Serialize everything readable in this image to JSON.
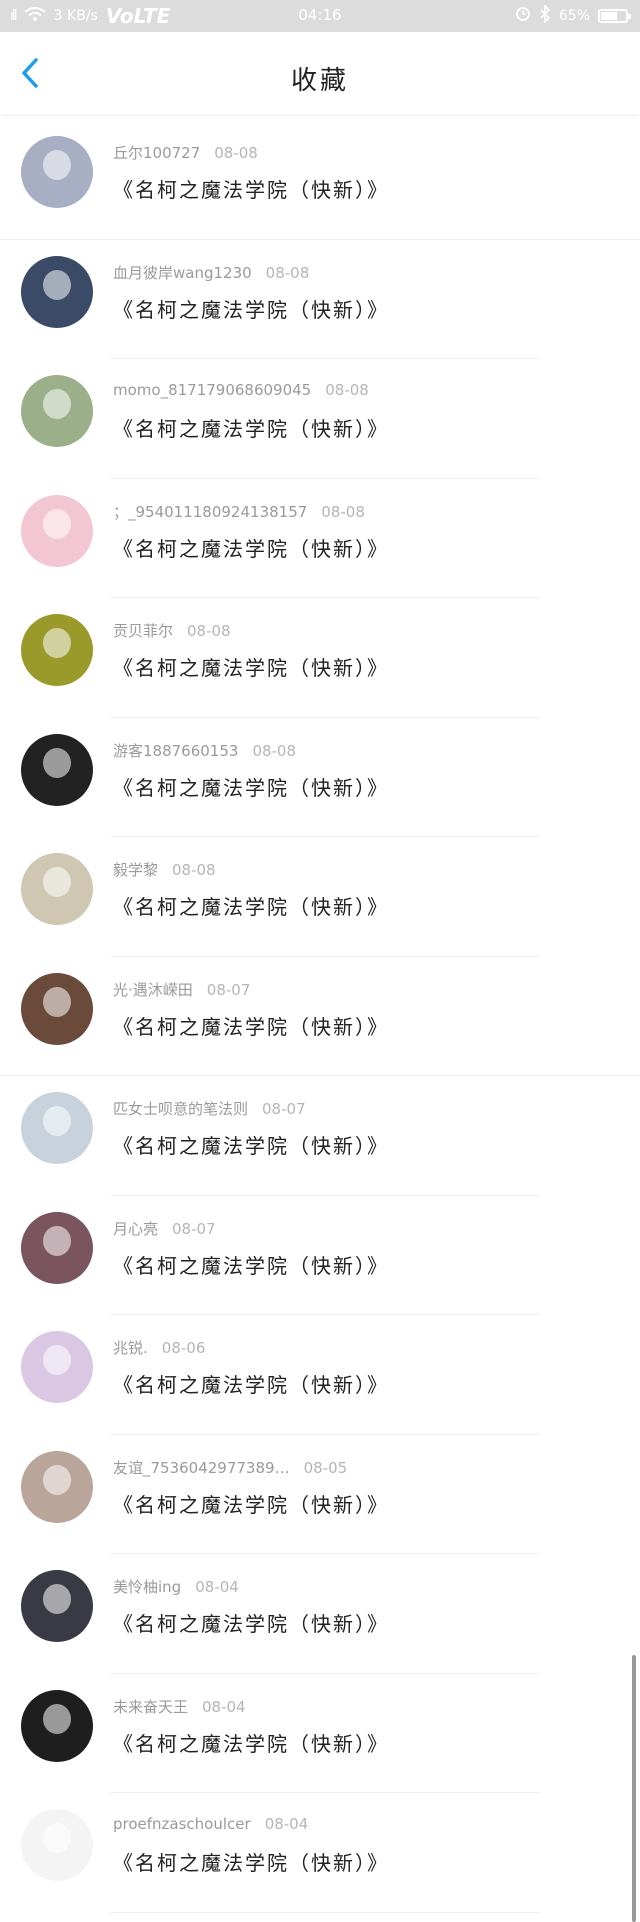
{
  "status_bar": {
    "signal": "ıll",
    "network_speed": "3 KB/s",
    "volte": "VoLTE",
    "time": "04:16",
    "battery_percent": "65%",
    "battery_level": 0.65
  },
  "header": {
    "title": "收藏"
  },
  "items": [
    {
      "user": "丘尔100727",
      "date": "08-08",
      "content": "《名柯之魔法学院（快新）》",
      "avatar_color": "#a8aec4"
    },
    {
      "user": "血月彼岸wang1230",
      "date": "08-08",
      "content": "《名柯之魔法学院（快新）》",
      "avatar_color": "#3b4a66"
    },
    {
      "user": "momo_817179068609045",
      "date": "08-08",
      "content": "《名柯之魔法学院（快新）》",
      "avatar_color": "#9bb08a"
    },
    {
      "user": "；_954011180924138157",
      "date": "08-08",
      "content": "《名柯之魔法学院（快新）》",
      "avatar_color": "#f3c6d3"
    },
    {
      "user": "贡贝菲尔",
      "date": "08-08",
      "content": "《名柯之魔法学院（快新）》",
      "avatar_color": "#9a9a2a"
    },
    {
      "user": "游客1887660153",
      "date": "08-08",
      "content": "《名柯之魔法学院（快新）》",
      "avatar_color": "#222222"
    },
    {
      "user": "毅学黎",
      "date": "08-08",
      "content": "《名柯之魔法学院（快新）》",
      "avatar_color": "#cfc7b2"
    },
    {
      "user": "光·遇沐嵘田",
      "date": "08-07",
      "content": "《名柯之魔法学院（快新）》",
      "avatar_color": "#6a4a3a"
    },
    {
      "user": "匹女士呗意的笔法则",
      "date": "08-07",
      "content": "《名柯之魔法学院（快新）》",
      "avatar_color": "#c7d2dc"
    },
    {
      "user": "月心亮",
      "date": "08-07",
      "content": "《名柯之魔法学院（快新）》",
      "avatar_color": "#7a5560"
    },
    {
      "user": "兆锐.",
      "date": "08-06",
      "content": "《名柯之魔法学院（快新）》",
      "avatar_color": "#d9c7e3"
    },
    {
      "user": "友谊_7536042977389…",
      "date": "08-05",
      "content": "《名柯之魔法学院（快新）》",
      "avatar_color": "#b9a59a"
    },
    {
      "user": "美怜柚ing",
      "date": "08-04",
      "content": "《名柯之魔法学院（快新）》",
      "avatar_color": "#3a3a45"
    },
    {
      "user": "未来奋天王",
      "date": "08-04",
      "content": "《名柯之魔法学院（快新）》",
      "avatar_color": "#1e1e1e"
    },
    {
      "user": "proefnzaschoulcer",
      "date": "08-04",
      "content": "《名柯之魔法学院（快新）》",
      "avatar_color": "#f4f4f4"
    }
  ],
  "colors": {
    "accent": "#1e9cf0",
    "status_bar_bg": "#dcdcdc",
    "separator": "#f0f0f0"
  }
}
